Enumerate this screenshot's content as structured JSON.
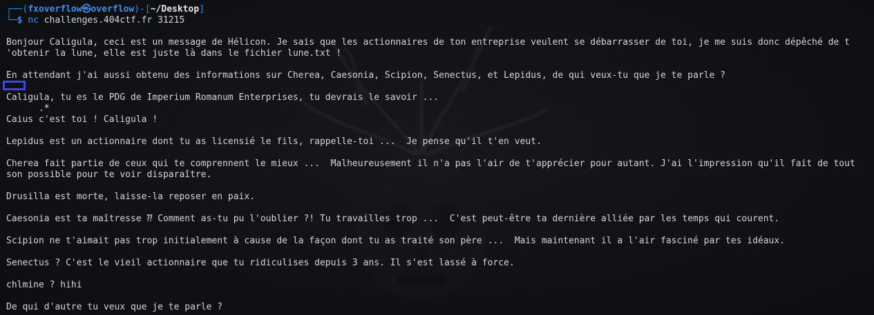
{
  "prompt": {
    "frame_top": "┌──(",
    "user": "fxoverflow",
    "at_symbol": "㉿",
    "host": "overflow",
    "frame_mid": ")-[",
    "path": "~/Desktop",
    "frame_end": "]",
    "frame_bottom": "└─",
    "dollar": "$",
    "command": "nc",
    "arguments": "challenges.404ctf.fr 31215"
  },
  "output": {
    "intro_line1": "Bonjour Caligula, ceci est un message de Hélicon. Je sais que les actionnaires de ton entreprise veulent se débarrasser de toi, je me suis donc dépêché de t",
    "intro_line2": "'obtenir la lune, elle est juste là dans le fichier lune.txt !",
    "question": "En attendant j'ai aussi obtenu des informations sur Cherea, Caesonia, Scipion, Senectus, et Lepidus, de qui veux-tu que je te parle ?",
    "user_input": ".*",
    "caligula": "Caligula, tu es le PDG de Imperium Romanum Enterprises, tu devrais le savoir ...",
    "caius": "Caius c'est toi ! Caligula !",
    "lepidus": "Lepidus est un actionnaire dont tu as licensié le fils, rappelle-toi ...  Je pense qu'il t'en veut.",
    "cherea_line1": "Cherea fait partie de ceux qui te comprennent le mieux ...  Malheureusement il n'a pas l'air de t'apprécier pour autant. J'ai l'impression qu'il fait de tout",
    "cherea_line2": "son possible pour te voir disparaître.",
    "drusilla": "Drusilla est morte, laisse-la reposer en paix.",
    "caesonia": "Caesonia est ta maîtresse ⁇ Comment as-tu pu l'oublier ?! Tu travailles trop ...  C'est peut-être ta dernière alliée par les temps qui courent.",
    "scipion": "Scipion ne t'aimait pas trop initialement à cause de la façon dont tu as traité son père ...  Mais maintenant il a l'air fasciné par tes idéaux.",
    "senectus": "Senectus ? C'est le vieil actionnaire que tu ridiculises depuis 3 ans. Il s'est lassé à force.",
    "chlmine": "chlmine ? hihi",
    "final_question": "De qui d'autre tu veux que je te parle ?"
  },
  "colors": {
    "background": "#111215",
    "prompt_blue": "#3b8eea",
    "text": "#d6d6d6",
    "highlight_box": "#3b49d6"
  }
}
